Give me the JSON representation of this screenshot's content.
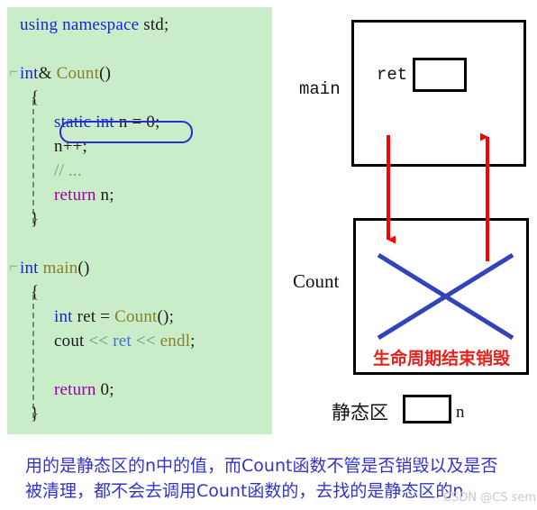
{
  "code": {
    "background_color": "#c9ecc9",
    "lines": [
      {
        "indent": 0,
        "fold": false,
        "tokens": [
          {
            "t": "using namespace ",
            "c": "kw"
          },
          {
            "t": "std;",
            "c": "pl"
          }
        ]
      },
      {
        "indent": 0,
        "fold": false,
        "tokens": []
      },
      {
        "indent": 0,
        "fold": true,
        "tokens": [
          {
            "t": "int",
            "c": "kw"
          },
          {
            "t": "& ",
            "c": "pl"
          },
          {
            "t": "Count",
            "c": "fn"
          },
          {
            "t": "()",
            "c": "pl"
          }
        ]
      },
      {
        "indent": 1,
        "fold": false,
        "tokens": [
          {
            "t": "{",
            "c": "pl"
          }
        ]
      },
      {
        "indent": 2,
        "fold": false,
        "tokens": [
          {
            "t": "static int ",
            "c": "kw"
          },
          {
            "t": "n = 0;",
            "c": "pl"
          }
        ]
      },
      {
        "indent": 2,
        "fold": false,
        "tokens": [
          {
            "t": "n++;",
            "c": "pl"
          }
        ]
      },
      {
        "indent": 2,
        "fold": false,
        "tokens": [
          {
            "t": "// ...",
            "c": "cm"
          }
        ]
      },
      {
        "indent": 2,
        "fold": false,
        "tokens": [
          {
            "t": "return",
            "c": "kw2"
          },
          {
            "t": " n;",
            "c": "pl"
          }
        ]
      },
      {
        "indent": 1,
        "fold": false,
        "tokens": [
          {
            "t": "}",
            "c": "pl"
          }
        ]
      },
      {
        "indent": 0,
        "fold": false,
        "tokens": []
      },
      {
        "indent": 0,
        "fold": true,
        "tokens": [
          {
            "t": "int",
            "c": "kw"
          },
          {
            "t": " ",
            "c": "pl"
          },
          {
            "t": "main",
            "c": "fn"
          },
          {
            "t": "()",
            "c": "pl"
          }
        ]
      },
      {
        "indent": 1,
        "fold": false,
        "tokens": [
          {
            "t": "{",
            "c": "pl"
          }
        ]
      },
      {
        "indent": 2,
        "fold": false,
        "tokens": [
          {
            "t": "int",
            "c": "kw"
          },
          {
            "t": " ret = ",
            "c": "pl"
          },
          {
            "t": "Count",
            "c": "fn"
          },
          {
            "t": "();",
            "c": "pl"
          }
        ]
      },
      {
        "indent": 2,
        "fold": false,
        "tokens": [
          {
            "t": "cout ",
            "c": "pl"
          },
          {
            "t": "<<",
            "c": "op"
          },
          {
            "t": " ",
            "c": "pl"
          },
          {
            "t": "ret",
            "c": "var"
          },
          {
            "t": " ",
            "c": "pl"
          },
          {
            "t": "<<",
            "c": "op"
          },
          {
            "t": " ",
            "c": "pl"
          },
          {
            "t": "endl",
            "c": "fn"
          },
          {
            "t": ";",
            "c": "pl"
          }
        ]
      },
      {
        "indent": 2,
        "fold": false,
        "tokens": []
      },
      {
        "indent": 2,
        "fold": false,
        "tokens": [
          {
            "t": "return",
            "c": "kw2"
          },
          {
            "t": " 0;",
            "c": "pl"
          }
        ]
      },
      {
        "indent": 1,
        "fold": false,
        "tokens": [
          {
            "t": "}",
            "c": "pl"
          }
        ]
      }
    ],
    "highlight": {
      "text": "static int n = 0;",
      "border_color": "#2b2bd4"
    },
    "fold_glyph": "⌐"
  },
  "diagram": {
    "main_label": "main",
    "count_label": "Count",
    "ret_label": "ret",
    "static_area_label": "静态区",
    "static_var_label": "n",
    "destroy_text": "生命周期结束销毁",
    "destroy_color": "#e8211c",
    "arrow_color": "#ff0000",
    "cross_color": "#3344bb",
    "box_border_color": "#000000",
    "call_arrow_direction": "down",
    "return_arrow_direction": "up"
  },
  "caption": {
    "line1": "用的是静态区的n中的值，而Count函数不管是否销毁以及是否",
    "line2": "被清理，都不会去调用Count函数的，去找的是静态区的n",
    "color": "#3333cc"
  },
  "watermark": {
    "text": "CSDN @CS semi"
  }
}
